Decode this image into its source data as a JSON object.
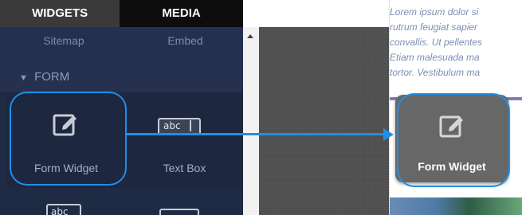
{
  "tabs": {
    "widgets": "WIDGETS",
    "media": "MEDIA"
  },
  "previous_row": {
    "left": "Sitemap",
    "right": "Embed"
  },
  "section": {
    "arrow": "▼",
    "label": "FORM"
  },
  "widgets": [
    {
      "label": "Form Widget",
      "icon": "edit-form-icon"
    },
    {
      "label": "Text Box",
      "icon": "text-box-icon"
    }
  ],
  "next_row_icon_text": "abc",
  "text_box_icon_text": "abc",
  "page_text": [
    "Lorem ipsum dolor si",
    "rutrum feugiat sapier",
    "convallis. Ut pellentes",
    "Etiam malesuada ma",
    "tortor. Vestibulum ma"
  ],
  "dropped_widget": {
    "label": "Form Widget",
    "icon": "edit-form-icon"
  },
  "colors": {
    "highlight": "#1e8fe6",
    "panel": "#1f2a44",
    "card": "#676767"
  }
}
